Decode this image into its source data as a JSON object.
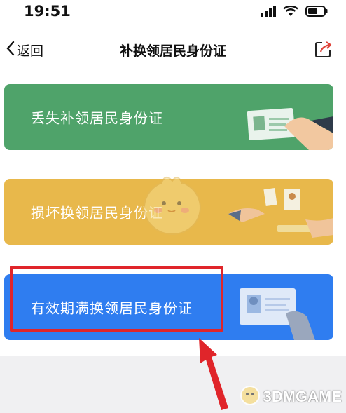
{
  "status_bar": {
    "time": "19:51"
  },
  "nav": {
    "back_label": "返回",
    "title": "补换领居民身份证"
  },
  "cards": [
    {
      "label": "丢失补领居民身份证",
      "color": "#4fa36a"
    },
    {
      "label": "损坏换领居民身份证",
      "color": "#e8b84b"
    },
    {
      "label": "有效期满换领居民身份证",
      "color": "#2f7df0"
    }
  ],
  "annotation": {
    "highlight_color": "#e0252a"
  },
  "watermark": {
    "text": "3DMGAME"
  },
  "icons": [
    "signal-icon",
    "wifi-icon",
    "battery-icon",
    "back-chevron-icon",
    "share-icon",
    "id-card-illustration",
    "mascot-watermark",
    "arrow-annotation"
  ]
}
